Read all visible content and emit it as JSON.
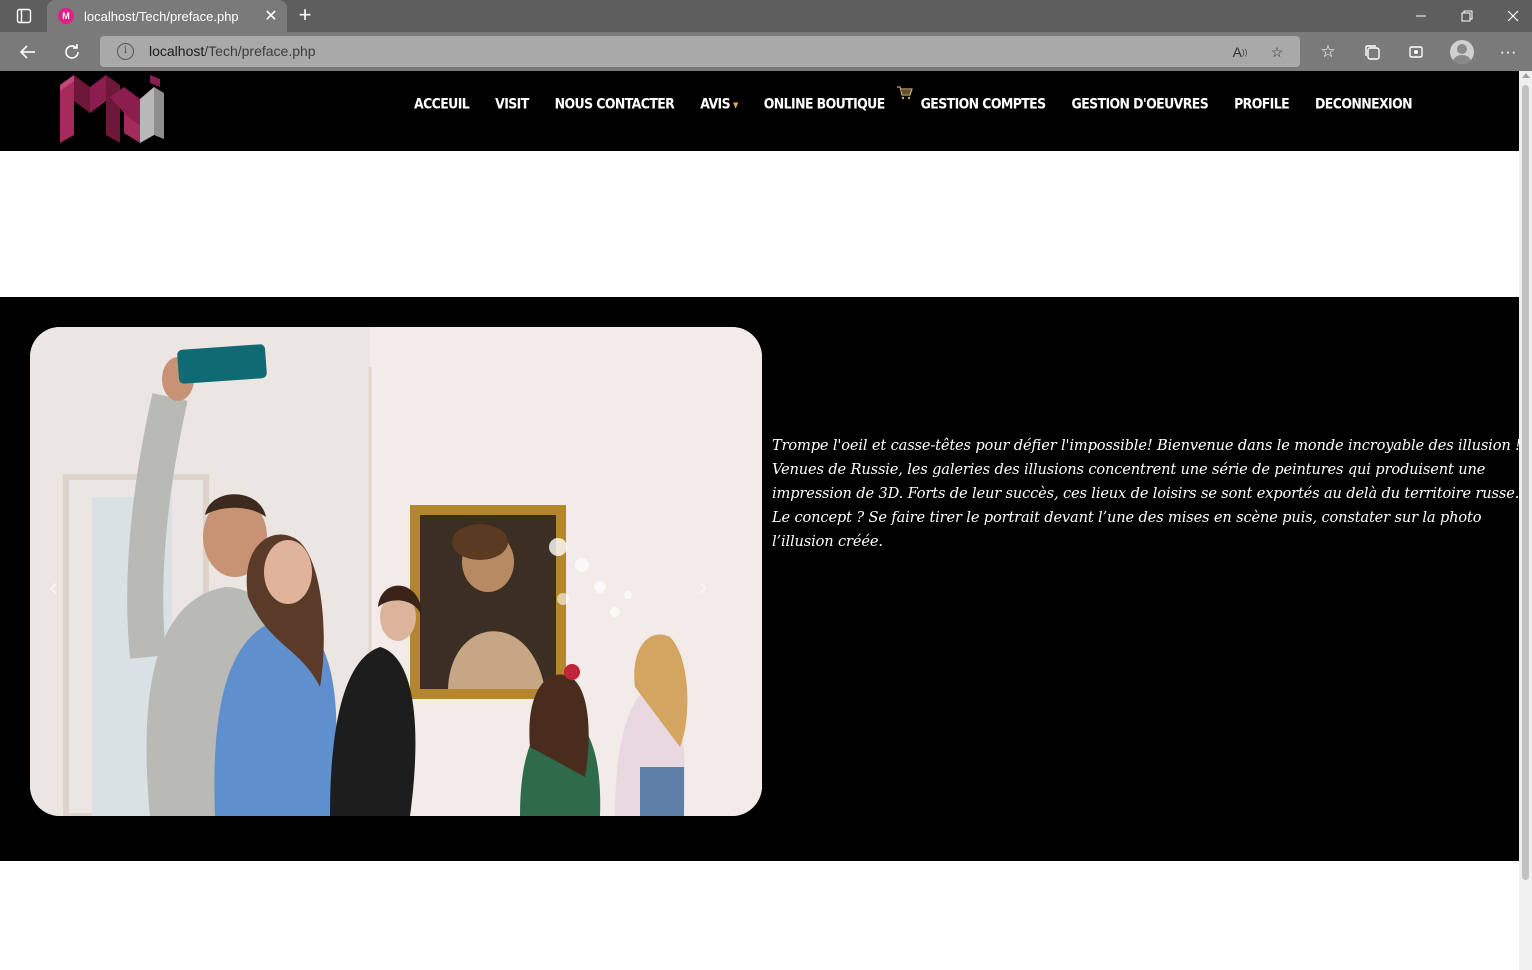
{
  "browser": {
    "tab_title": "localhost/Tech/preface.php",
    "url_host": "localhost",
    "url_path": "/Tech/preface.php",
    "favicon_letter": "M"
  },
  "site": {
    "logo_name": "MAI logo",
    "menu": [
      {
        "label": "ACCEUIL"
      },
      {
        "label": "VISIT"
      },
      {
        "label": "NOUS CONTACTER"
      },
      {
        "label": "AVIS"
      },
      {
        "label": "ONLINE BOUTIQUE"
      },
      {
        "label": "GESTION COMPTES"
      },
      {
        "label": "GESTION D'OEUVRES"
      },
      {
        "label": "PROFILE"
      },
      {
        "label": "DECONNEXION"
      }
    ]
  },
  "hero": {
    "intro": "Trompe l'oeil et casse-têtes pour défier l'impossible! Bienvenue dans le monde incroyable des illusion ! Venues de Russie, les galeries des illusions concentrent une série de peintures qui produisent une impression de 3D. Forts de leur succès, ces lieux de loisirs se sont exportés au delà du territoire russe. Le concept ? Se faire tirer le portrait devant l’une des mises en scène puis, constater sur la photo l’illusion créée."
  },
  "colors": {
    "brand_magenta": "#8b1e4e",
    "nav_bg": "#000000",
    "caret_gold": "#d8b24a"
  }
}
